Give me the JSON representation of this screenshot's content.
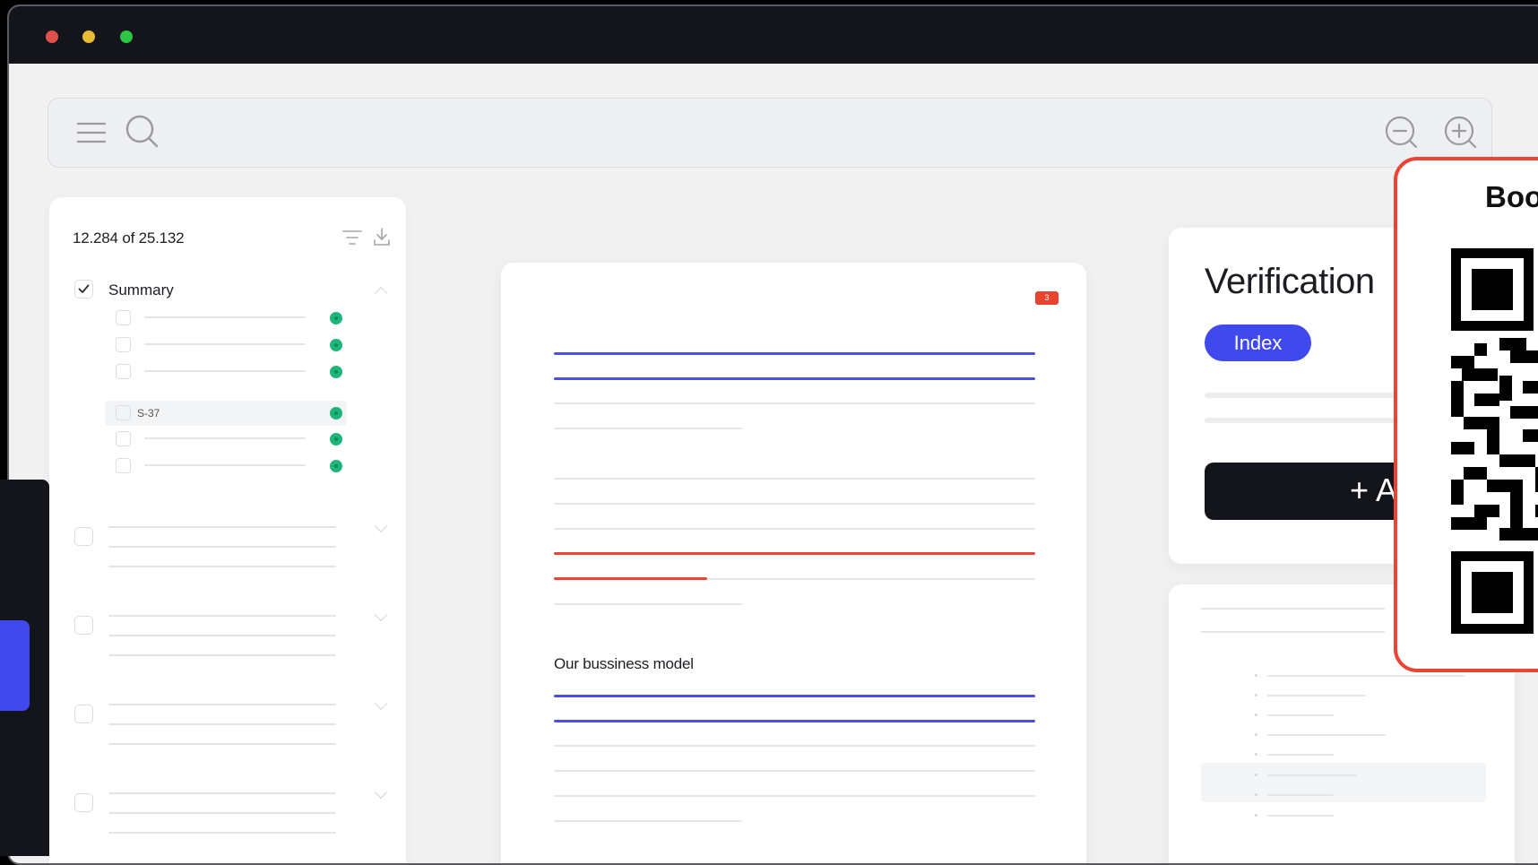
{
  "window": {
    "traffic_lights": [
      "#e0504a",
      "#e6bb34",
      "#2ec446"
    ],
    "icons": [
      "menu-icon",
      "search-icon",
      "zoom-out-icon",
      "zoom-in-icon"
    ]
  },
  "left_panel": {
    "count": "12.284 of 25.132",
    "icons": [
      "filter-icon",
      "download-icon"
    ],
    "summary_label": "Summary",
    "highlighted_item": "S-37",
    "status_color": "#1fb57a"
  },
  "document": {
    "page_badge": "3",
    "section_heading": "Our bussiness model",
    "accent_blue": "#4a4dea",
    "accent_red": "#ea4434"
  },
  "verification": {
    "title": "Verification",
    "tag": "Index",
    "add_button": "+ A"
  },
  "qr_card": {
    "title": "Boo",
    "border_color": "#ea4434"
  }
}
